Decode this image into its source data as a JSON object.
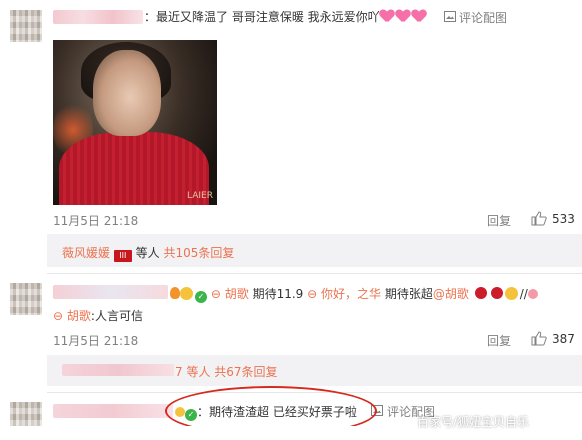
{
  "comment1": {
    "text": "：最近又降温了 哥哥注意保暖 我永远爱你吖",
    "review_link": "评论配图",
    "time": "11月5日 21:18",
    "reply_label": "回复",
    "like_count": "533",
    "replies_prefix": "薇风媛媛",
    "replies_mid": "等人",
    "replies_link": "共105条回复",
    "photo_watermark": "LAIER"
  },
  "comment2": {
    "mention1": "胡歌",
    "text1": "期待11.9",
    "text2": "你好，之华",
    "text3": "期待张超",
    "mention2": "@胡歌",
    "text4": "//",
    "line2_user": "胡歌",
    "line2_text": ":人言可信",
    "time": "11月5日 21:18",
    "reply_label": "回复",
    "like_count": "387",
    "replies_suffix": "7 等人",
    "replies_link": "共67条回复"
  },
  "comment3": {
    "text": "：期待渣渣超 已经买好票子啦",
    "review_link": "评论配图"
  },
  "watermark": "百家号/狐妞宝贝自乐",
  "colors": {
    "link": "#eb7350",
    "oval": "#d52a1f"
  }
}
